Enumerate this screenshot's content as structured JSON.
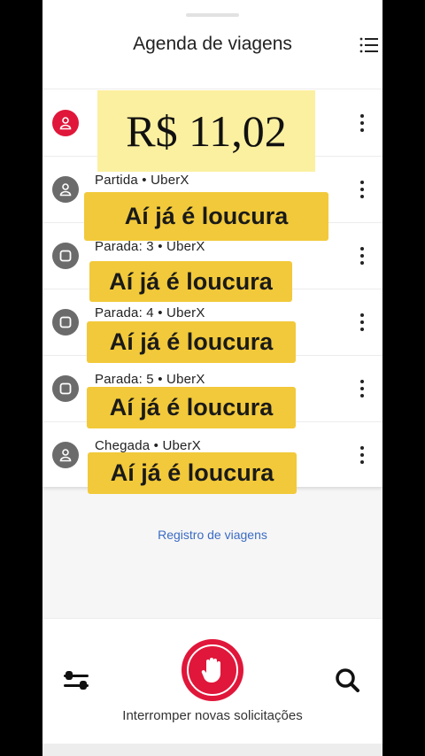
{
  "header": {
    "title": "Agenda de viagens"
  },
  "rows": [
    {
      "label": "",
      "type": "R$ 11,02",
      "active": true
    },
    {
      "label": "Partida",
      "type": "UberX"
    },
    {
      "label": "Parada: 3",
      "type": "UberX"
    },
    {
      "label": "Parada: 4",
      "type": "UberX"
    },
    {
      "label": "Parada: 5",
      "type": "UberX"
    },
    {
      "label": "Chegada",
      "type": "UberX"
    }
  ],
  "overlays": {
    "price": "R$ 11,02",
    "caption": "Aí já é loucura"
  },
  "footer": {
    "history_link": "Registro de viagens",
    "stop_label": "Interromper novas solicitações"
  },
  "colors": {
    "accent": "#e0173a",
    "highlight": "#f2c93a",
    "link": "#3b6bc4"
  }
}
